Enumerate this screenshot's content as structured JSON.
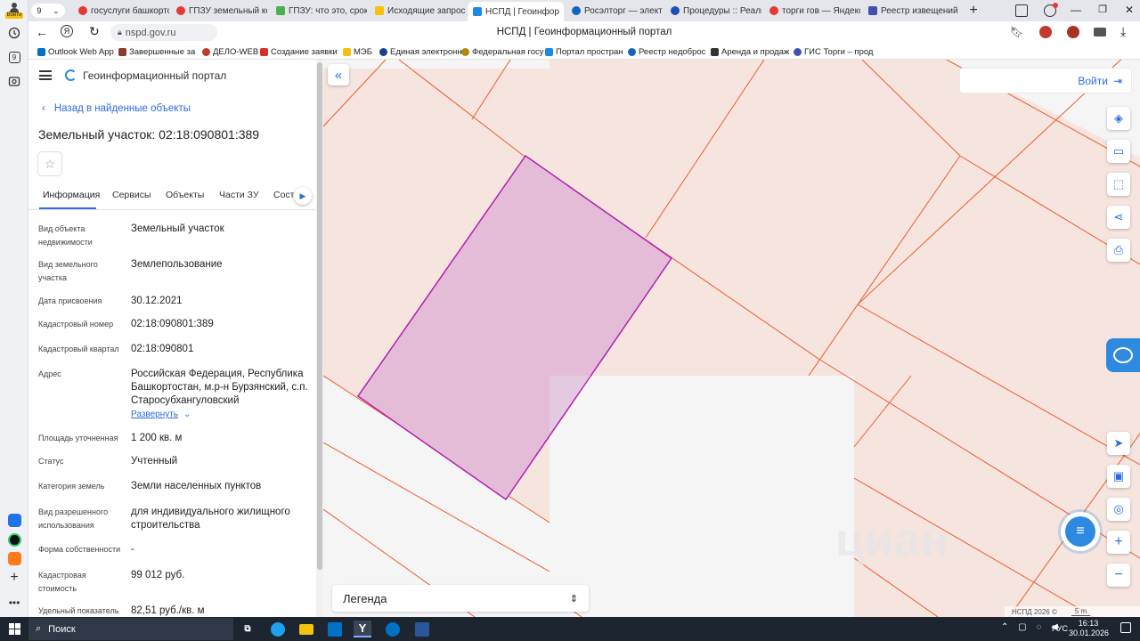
{
  "browser": {
    "tab_count": "9",
    "profile_label": "Войти",
    "tabs": [
      {
        "title": "госуслуги башкорто",
        "fav_color": "#e53935"
      },
      {
        "title": "ГПЗУ земельный ко",
        "fav_color": "#e53935"
      },
      {
        "title": "ГПЗУ: что это, срок",
        "fav_color": "#4caf50"
      },
      {
        "title": "Исходящие запросы",
        "fav_color": "#f4c20d"
      },
      {
        "title": "НСПД | Геоинфор",
        "fav_color": "#1e88e5"
      },
      {
        "title": "Росэлторг — электр",
        "fav_color": "#1565c0"
      },
      {
        "title": "Процедуры :: Реали",
        "fav_color": "#1e4fb8"
      },
      {
        "title": "торги гов — Яндекс",
        "fav_color": "#e53935"
      },
      {
        "title": "Реестр извещений",
        "fav_color": "#3f51b5"
      }
    ],
    "url": "nspd.gov.ru",
    "page_title": "НСПД | Геоинформационный портал",
    "bookmarks": [
      {
        "label": "Outlook Web App",
        "color": "#0072c6"
      },
      {
        "label": "Завершенные за",
        "color": "#8d3b2c"
      },
      {
        "label": "ДЕЛО-WEB",
        "color": "#c0392b"
      },
      {
        "label": "Создание заявки",
        "color": "#d93025"
      },
      {
        "label": "МЭБ",
        "color": "#f4c20d"
      },
      {
        "label": "Единая электронн",
        "color": "#1a3e8f"
      },
      {
        "label": "Федеральная госу",
        "color": "#b8860b"
      },
      {
        "label": "Портал простран",
        "color": "#1e88e5"
      },
      {
        "label": "Реестр недоброс",
        "color": "#1565c0"
      },
      {
        "label": "Аренда и продаж",
        "color": "#333333"
      },
      {
        "label": "ГИС Торги – прод",
        "color": "#3f51b5"
      }
    ]
  },
  "portal": {
    "name": "Геоинформационный портал",
    "back_link": "Назад в найденные объекты",
    "object_title": "Земельный участок: 02:18:090801:389",
    "tabs": [
      "Информация",
      "Сервисы",
      "Объекты",
      "Части ЗУ",
      "Соста"
    ],
    "expand_link": "Развернуть",
    "fields": [
      {
        "label": "Вид объекта недвижимости",
        "value": "Земельный участок"
      },
      {
        "label": "Вид земельного участка",
        "value": "Землепользование"
      },
      {
        "label": "Дата присвоения",
        "value": "30.12.2021"
      },
      {
        "label": "Кадастровый номер",
        "value": "02:18:090801:389"
      },
      {
        "label": "Кадастровый квартал",
        "value": "02:18:090801"
      },
      {
        "label": "Адрес",
        "value": "Российская Федерация, Республика Башкортостан, м.р-н Бурзянский, с.п. Старосубхангуловский"
      },
      {
        "label": "Площадь уточненная",
        "value": "1 200 кв. м"
      },
      {
        "label": "Статус",
        "value": "Учтенный"
      },
      {
        "label": "Категория земель",
        "value": "Земли населенных пунктов"
      },
      {
        "label": "Вид разрешенного использования",
        "value": "для индивидуального жилищного строительства"
      },
      {
        "label": "Форма собственности",
        "value": "-"
      },
      {
        "label": "Кадастровая стоимость",
        "value": "99 012 руб."
      },
      {
        "label": "Удельный показатель",
        "value": "82,51 руб./кв. м"
      }
    ]
  },
  "map": {
    "login_label": "Войти",
    "legend_label": "Легенда",
    "copyright": "НСПД 2026 ©",
    "scale_label": "5 m",
    "watermark": "циан",
    "colors": {
      "background": "#f6e4de",
      "parcel_line": "#ef5a2b",
      "selected_fill": "#e4bcd8",
      "selected_stroke": "#b31fb0",
      "accent": "#2d6ae0"
    }
  },
  "taskbar": {
    "search_label": "Поиск",
    "language": "РУС",
    "time": "16:13",
    "date": "30.01.2026"
  }
}
